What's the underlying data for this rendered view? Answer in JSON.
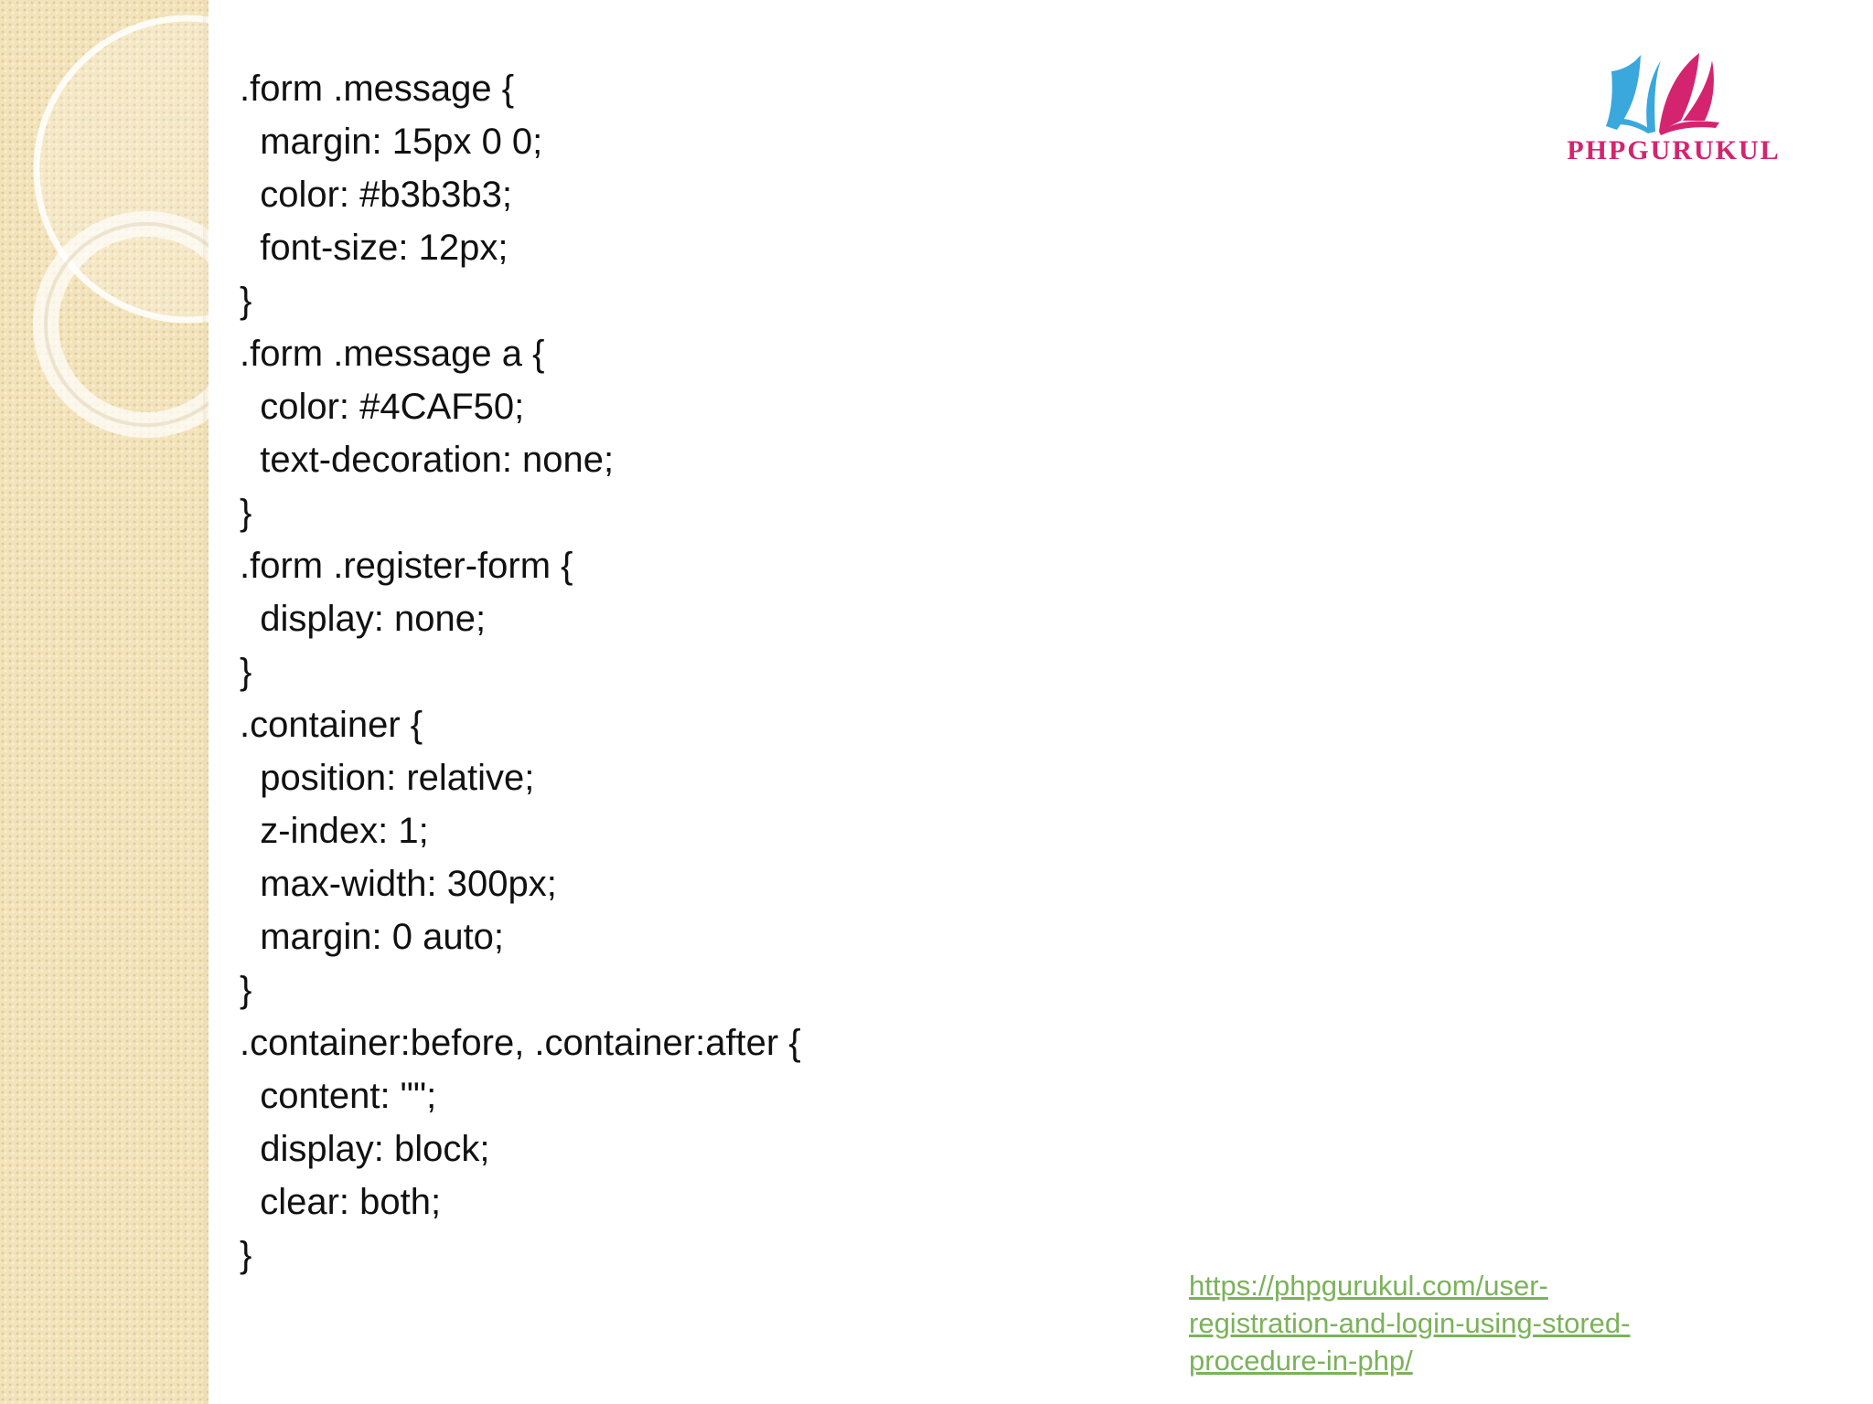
{
  "slide": {
    "code_lines": [
      ".form .message {",
      "  margin: 15px 0 0;",
      "  color: #b3b3b3;",
      "  font-size: 12px;",
      "}",
      ".form .message a {",
      "  color: #4CAF50;",
      "  text-decoration: none;",
      "}",
      ".form .register-form {",
      "  display: none;",
      "}",
      ".container {",
      "  position: relative;",
      "  z-index: 1;",
      "  max-width: 300px;",
      "  margin: 0 auto;",
      "}",
      ".container:before, .container:after {",
      "  content: \"\";",
      "  display: block;",
      "  clear: both;",
      "}"
    ],
    "logo": {
      "text": "PHPGURUKUL",
      "icon": "open-book-icon"
    },
    "source_link": {
      "lines": [
        "https://phpgurukul.com/user-",
        "registration-and-login-using-stored-",
        "procedure-in-php/"
      ]
    }
  },
  "colors": {
    "sidebar_bg": "#f3e3bb",
    "text": "#111111",
    "logo_pink": "#d4246f",
    "logo_blue": "#3aa7dd",
    "link_green": "#7bb25a"
  }
}
